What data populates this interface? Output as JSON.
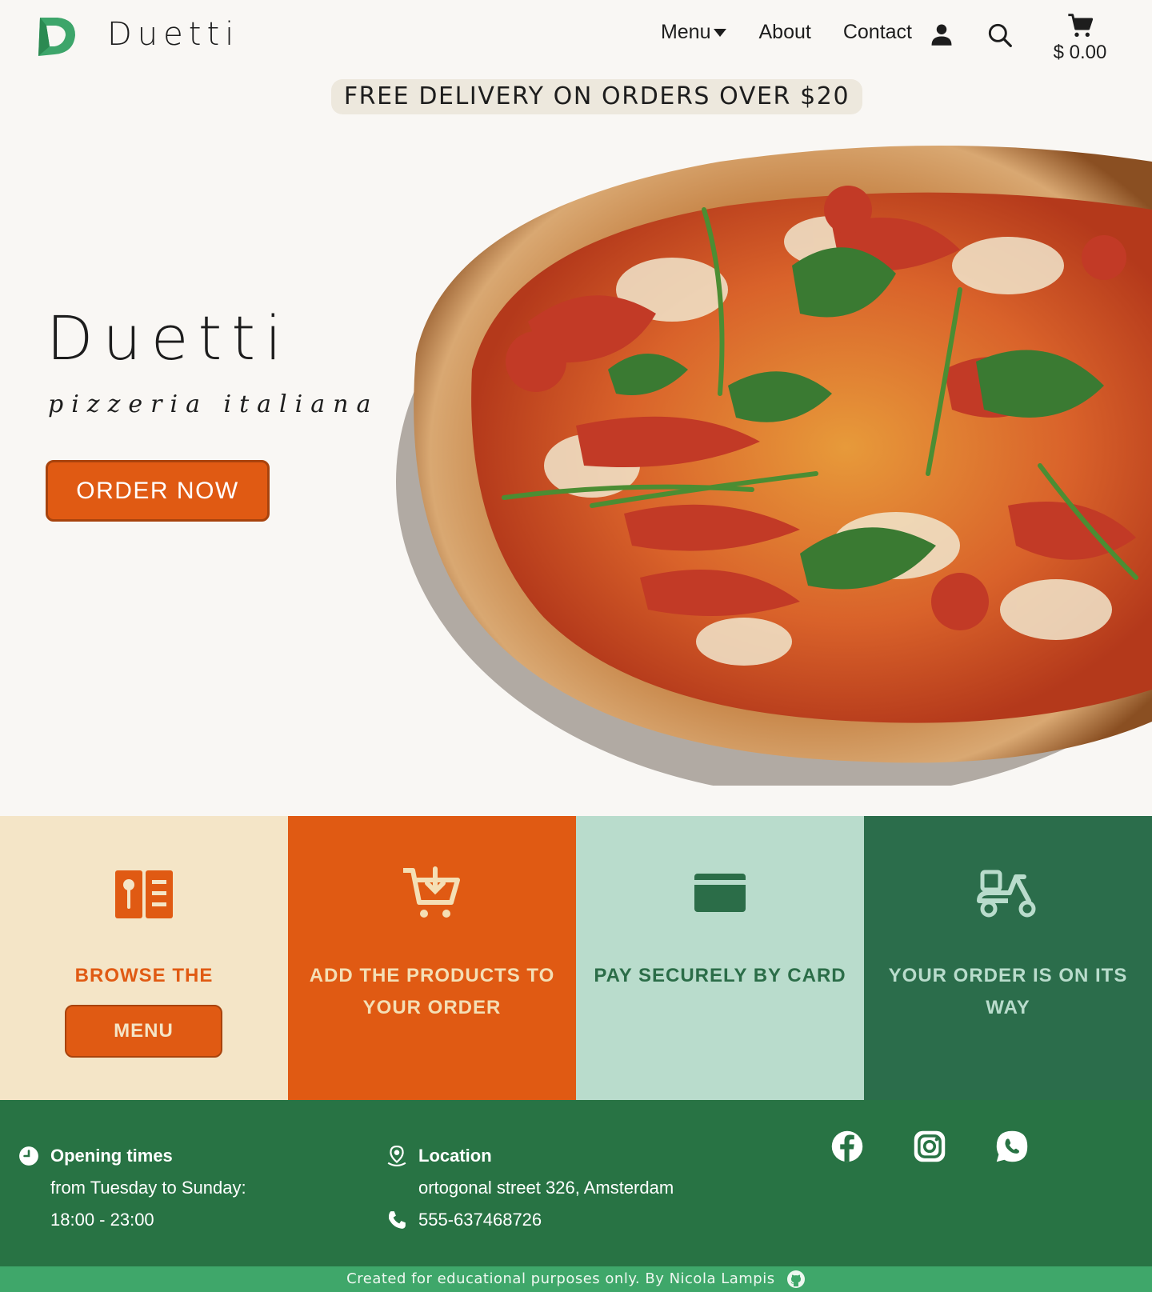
{
  "header": {
    "brand": "Duetti",
    "nav": {
      "menu": "Menu",
      "about": "About",
      "contact": "Contact"
    },
    "cart_total": "$ 0.00"
  },
  "promo": "FREE DELIVERY ON ORDERS OVER $20",
  "hero": {
    "title": "Duetti",
    "subtitle": "pizzeria italiana",
    "cta": "ORDER NOW"
  },
  "steps": [
    {
      "text": "BROWSE THE",
      "button": "MENU",
      "icon": "menu-book-icon"
    },
    {
      "text": "ADD THE PRODUCTS TO YOUR ORDER",
      "icon": "cart-add-icon"
    },
    {
      "text": "PAY SECURELY BY CARD",
      "icon": "credit-card-icon"
    },
    {
      "text": "YOUR ORDER IS ON ITS WAY",
      "icon": "scooter-icon"
    }
  ],
  "footer": {
    "hours": {
      "heading": "Opening times",
      "days": "from Tuesday to Sunday:",
      "time": "18:00 - 23:00"
    },
    "location": {
      "heading": "Location",
      "address": "ortogonal street 326, Amsterdam",
      "phone": "555-637468726"
    },
    "social": [
      "facebook-icon",
      "instagram-icon",
      "whatsapp-icon"
    ],
    "credits": "Created for educational purposes only.  By Nicola Lampis"
  },
  "colors": {
    "accent_orange": "#e05a13",
    "dark_green": "#287344",
    "light_green": "#b9dccc",
    "cream": "#f4e5c7",
    "background": "#f9f7f4"
  }
}
